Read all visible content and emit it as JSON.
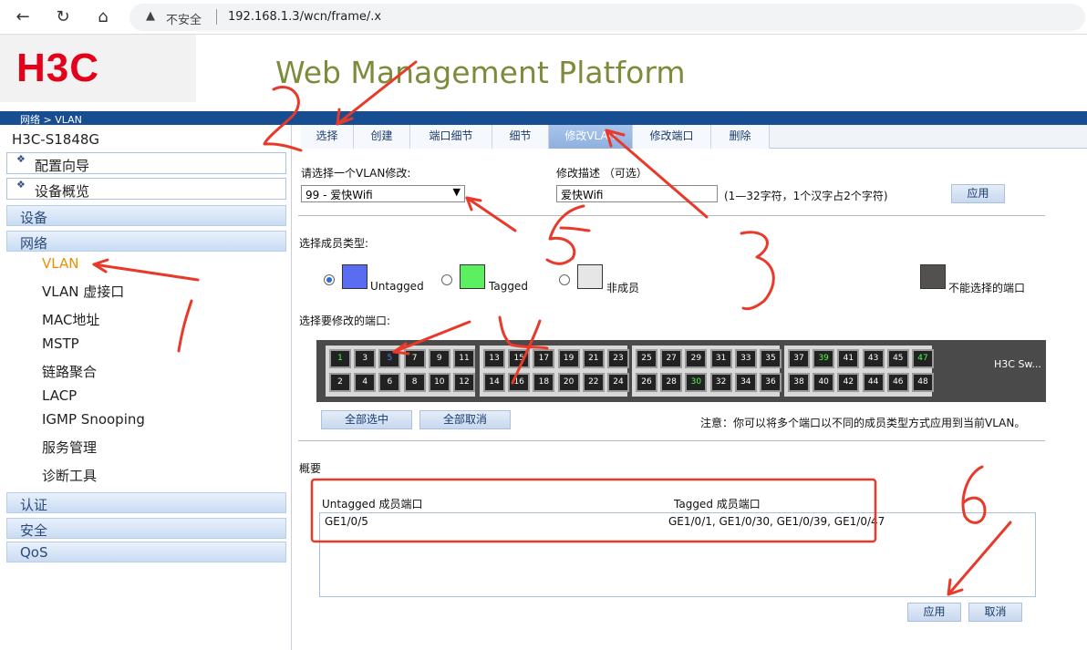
{
  "browser": {
    "back_icon": "arrow-left-icon",
    "reload_icon": "reload-icon",
    "home_icon": "home-icon",
    "insecure_label": "不安全",
    "url": "192.168.1.3/wcn/frame/.x"
  },
  "header": {
    "logo": "H3C",
    "platform_title": "Web Management Platform"
  },
  "breadcrumb": "网络 > VLAN",
  "sidebar": {
    "device_name": "H3C-S1848G",
    "boxes": [
      "配置向导",
      "设备概览"
    ],
    "categories_top": [
      "设备",
      "网络"
    ],
    "network_items": [
      "VLAN",
      "VLAN 虚接口",
      "MAC地址",
      "MSTP",
      "链路聚合",
      "LACP",
      "IGMP Snooping",
      "服务管理",
      "诊断工具"
    ],
    "active_item": "VLAN",
    "categories_bottom": [
      "认证",
      "安全",
      "QoS"
    ]
  },
  "tabs": [
    "选择",
    "创建",
    "端口细节",
    "细节",
    "修改VLAN",
    "修改端口",
    "删除"
  ],
  "active_tab": "修改VLAN",
  "form": {
    "select_vlan_label": "请选择一个VLAN修改:",
    "select_vlan_value": "99 - 爱快Wifi",
    "desc_label": "修改描述 （可选）",
    "desc_value": "爱快Wifi",
    "desc_hint": "(1—32字符，1个汉字占2个字符)",
    "apply_label": "应用"
  },
  "member_type": {
    "label": "选择成员类型:",
    "options": [
      {
        "label": "Untagged",
        "color": "#5a6cf0",
        "selected": true
      },
      {
        "label": "Tagged",
        "color": "#5cf060",
        "selected": false
      },
      {
        "label": "非成员",
        "color": "#e6e6e6",
        "selected": false
      }
    ],
    "not_selectable_label": "不能选择的端口",
    "not_selectable_color": "#555050"
  },
  "ports": {
    "label": "选择要修改的端口:",
    "switch_name": "H3C Sw...",
    "top_row": [
      "1",
      "3",
      "5",
      "7",
      "9",
      "11",
      "13",
      "15",
      "17",
      "19",
      "21",
      "23",
      "25",
      "27",
      "29",
      "31",
      "33",
      "35",
      "37",
      "39",
      "41",
      "43",
      "45",
      "47"
    ],
    "bottom_row": [
      "2",
      "4",
      "6",
      "8",
      "10",
      "12",
      "14",
      "16",
      "18",
      "20",
      "22",
      "24",
      "26",
      "28",
      "30",
      "32",
      "34",
      "36",
      "38",
      "40",
      "42",
      "44",
      "46",
      "48"
    ],
    "tagged_ports": [
      "1",
      "30",
      "39",
      "47"
    ],
    "untagged_ports": [
      "5"
    ],
    "select_all": "全部选中",
    "deselect_all": "全部取消",
    "note": "注意：你可以将多个端口以不同的成员类型方式应用到当前VLAN。"
  },
  "summary": {
    "title": "概要",
    "untagged_header": "Untagged 成员端口",
    "tagged_header": "Tagged 成员端口",
    "untagged_value": "GE1/0/5",
    "tagged_value": "GE1/0/1, GE1/0/30, GE1/0/39, GE1/0/47"
  },
  "footer_buttons": {
    "apply": "应用",
    "cancel": "取消"
  }
}
